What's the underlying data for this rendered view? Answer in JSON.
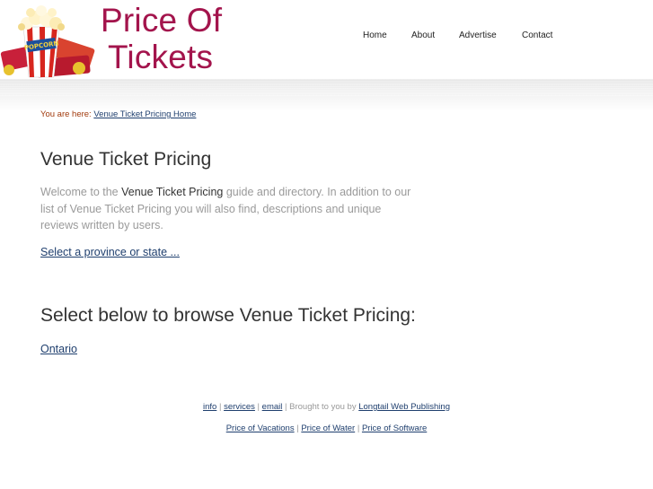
{
  "site": {
    "logo_line1": "Price Of",
    "logo_line2": "Tickets",
    "logo_image_label": "POPCORN",
    "brand_color": "#a3144c"
  },
  "nav": {
    "items": [
      {
        "label": "Home"
      },
      {
        "label": "About"
      },
      {
        "label": "Advertise"
      },
      {
        "label": "Contact"
      }
    ]
  },
  "breadcrumb": {
    "prefix": "You are here:",
    "link": "Venue Ticket Pricing Home"
  },
  "main": {
    "title": "Venue Ticket Pricing",
    "intro_before": "Welcome to the",
    "intro_strong": "Venue Ticket Pricing",
    "intro_after": "guide and directory. In addition to our list of Venue Ticket Pricing you will also find, descriptions and unique reviews written by users.",
    "select_link": "Select a province or state ...",
    "browse_heading": "Select below to browse Venue Ticket Pricing:",
    "regions": [
      "Ontario"
    ]
  },
  "footer": {
    "links1": [
      "info",
      "services",
      "email"
    ],
    "brought_by": "Brought to you by",
    "publisher": "Longtail Web Publishing",
    "links2": [
      "Price of Vacations",
      "Price of Water",
      "Price of Software"
    ]
  },
  "colors": {
    "link": "#1f3f6e",
    "breadcrumb_prefix": "#a13a0c",
    "muted_text": "#9a9a9a"
  }
}
